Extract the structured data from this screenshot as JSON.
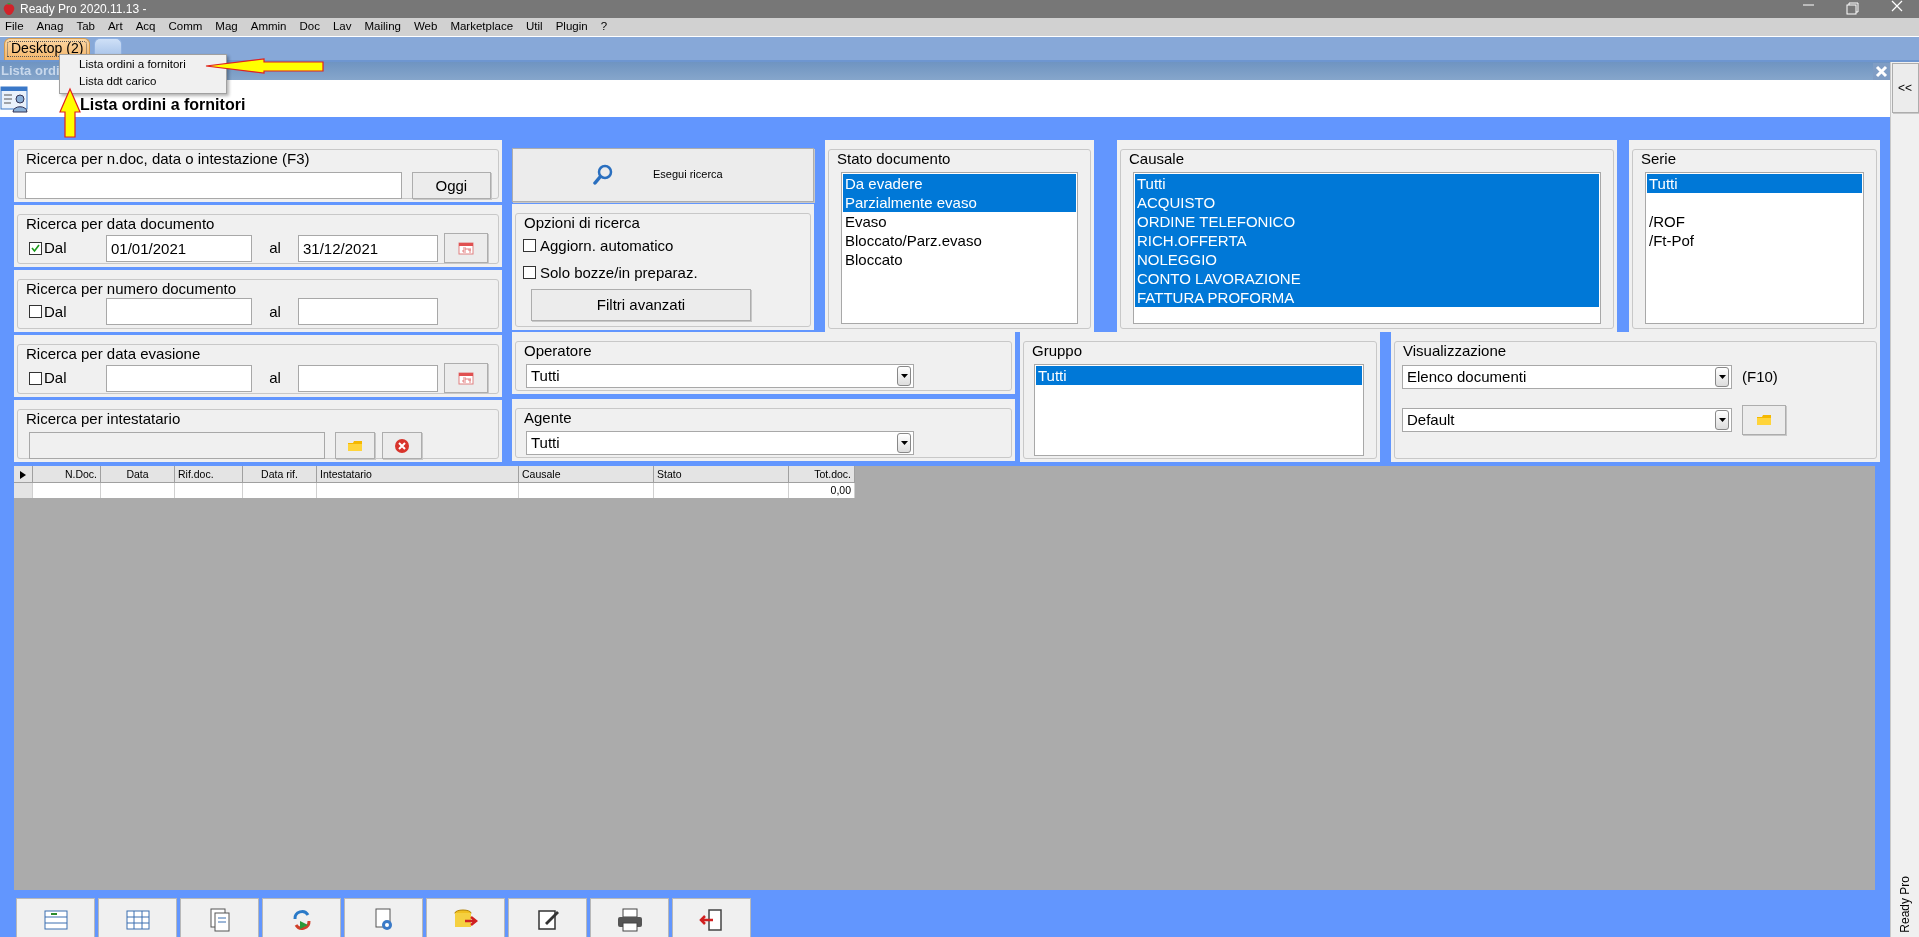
{
  "window": {
    "title": "Ready Pro 2020.11.13 -"
  },
  "menu": [
    "File",
    "Anag",
    "Tab",
    "Art",
    "Acq",
    "Comm",
    "Mag",
    "Ammin",
    "Doc",
    "Lav",
    "Mailing",
    "Web",
    "Marketplace",
    "Util",
    "Plugin",
    "?"
  ],
  "tabs": [
    {
      "label": "Desktop (2)",
      "selected": true
    },
    {
      "selected": false
    }
  ],
  "popup_menu": {
    "items": [
      "Lista ordini a fornitori",
      "Lista ddt carico"
    ]
  },
  "child_window": {
    "title": "Lista ordi"
  },
  "header": {
    "title": "Lista ordini a fornitori"
  },
  "side_panel": {
    "collapse": "<<",
    "label": "Ready Pro"
  },
  "quick_search": {
    "title": "Ricerca per n.doc, data o intestazione (F3)",
    "button": "Oggi"
  },
  "range_filters": [
    {
      "title": "Ricerca per data documento",
      "checkbox": "Dal",
      "checked": true,
      "from": "01/01/2021",
      "to_label": "al",
      "to": "31/12/2021",
      "calendar": true
    },
    {
      "title": "Ricerca per numero documento",
      "checkbox": "Dal",
      "checked": false,
      "to_label": "al",
      "calendar": false
    },
    {
      "title": "Ricerca per data evasione",
      "checkbox": "Dal",
      "checked": false,
      "to_label": "al",
      "calendar": true
    }
  ],
  "holder_search": {
    "title": "Ricerca per intestatario"
  },
  "search_button": "Esegui ricerca",
  "options": {
    "title": "Opzioni di ricerca",
    "checks": [
      {
        "label": "Aggiorn. automatico",
        "checked": false
      },
      {
        "label": "Solo bozze/in preparaz.",
        "checked": false
      }
    ],
    "button": "Filtri avanzati"
  },
  "lists": [
    {
      "title": "Stato documento",
      "items": [
        {
          "kind": "option",
          "label": "Da evadere",
          "selected": true
        },
        {
          "kind": "option",
          "label": "Parzialmente evaso",
          "selected": true
        },
        {
          "kind": "option",
          "label": "Evaso",
          "selected": false
        },
        {
          "kind": "option",
          "label": "Bloccato/Parz.evaso",
          "selected": false
        },
        {
          "kind": "option",
          "label": "Bloccato",
          "selected": false
        }
      ]
    },
    {
      "title": "Causale",
      "items": [
        {
          "kind": "option",
          "label": "Tutti",
          "selected": true
        },
        {
          "kind": "option",
          "label": "ACQUISTO",
          "selected": true
        },
        {
          "kind": "option",
          "label": "ORDINE TELEFONICO",
          "selected": true
        },
        {
          "kind": "option",
          "label": "RICH.OFFERTA",
          "selected": true
        },
        {
          "kind": "option",
          "label": "NOLEGGIO",
          "selected": true
        },
        {
          "kind": "option",
          "label": "CONTO LAVORAZIONE",
          "selected": true
        },
        {
          "kind": "option",
          "label": "FATTURA PROFORMA",
          "selected": true
        }
      ]
    },
    {
      "title": "Serie",
      "items": [
        {
          "kind": "option",
          "label": "Tutti",
          "selected": true
        },
        {
          "kind": "spacer"
        },
        {
          "kind": "option",
          "label": "/ROF",
          "selected": false
        },
        {
          "kind": "option",
          "label": "/Ft-Pof",
          "selected": false
        }
      ]
    }
  ],
  "operator": {
    "title": "Operatore",
    "value": "Tutti"
  },
  "agent": {
    "title": "Agente",
    "value": "Tutti"
  },
  "group": {
    "title": "Gruppo",
    "items": [
      {
        "kind": "option",
        "label": "Tutti",
        "selected": true
      }
    ]
  },
  "view": {
    "title": "Visualizzazione",
    "layout": "Elenco documenti",
    "shortcut": "(F10)",
    "preset": "Default"
  },
  "table": {
    "columns": [
      "N.Doc.",
      "Data",
      "Rif.doc.",
      "Data rif.",
      "Intestatario",
      "Causale",
      "Stato",
      "Tot.doc."
    ],
    "rows": [
      {
        "total": "0,00"
      }
    ]
  }
}
